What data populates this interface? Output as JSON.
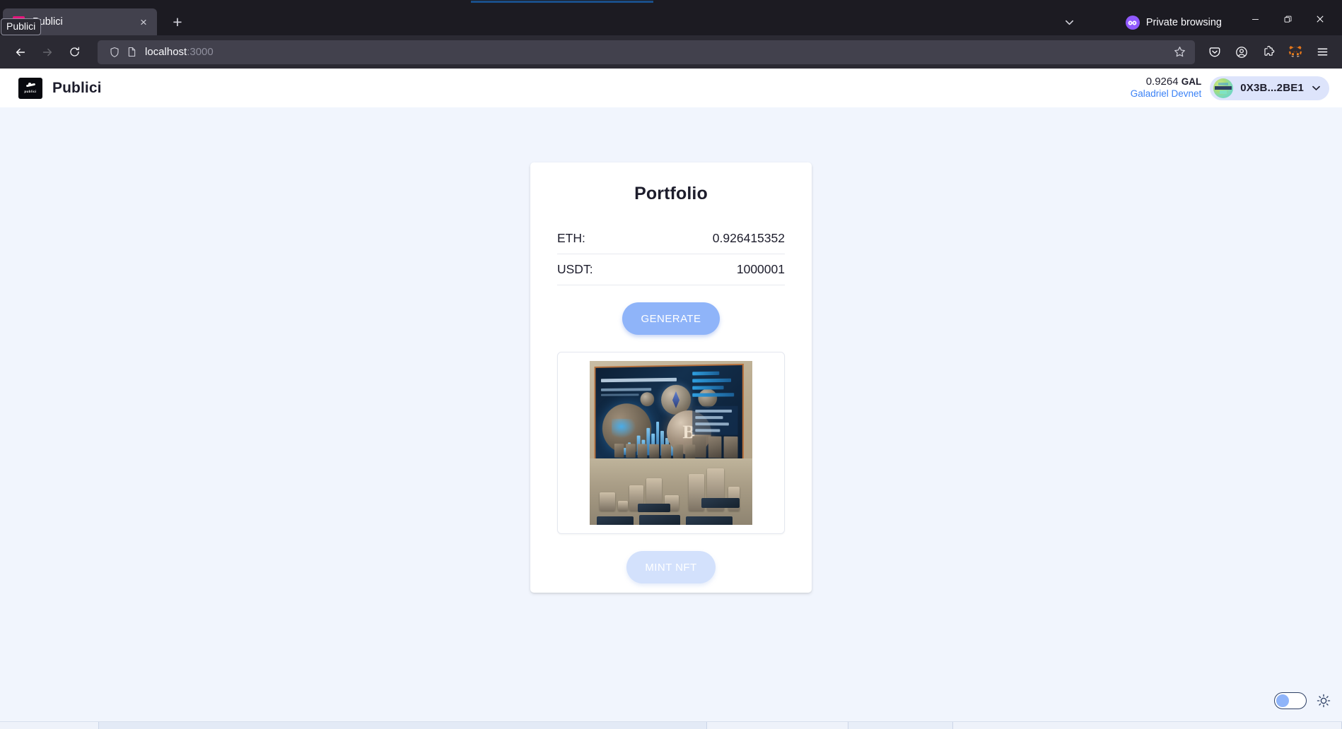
{
  "browser": {
    "tab": {
      "title": "Publici",
      "favicon_name": "publici-favicon",
      "close_label": "×",
      "tooltip": "Publici"
    },
    "new_tab_label": "+",
    "private_browsing_label": "Private browsing",
    "url": {
      "host": "localhost",
      "port": ":3000"
    },
    "window_controls": {
      "minimize": "—",
      "restore": "❐",
      "close": "✕"
    }
  },
  "app": {
    "brand": {
      "name": "Publici",
      "logo_wordmark": "publici"
    },
    "wallet": {
      "balance": "0.9264",
      "token": "GAL",
      "network": "Galadriel Devnet",
      "address": "0X3B...2BE1"
    },
    "card": {
      "title": "Portfolio",
      "rows": [
        {
          "label": "ETH:",
          "value": "0.926415352"
        },
        {
          "label": "USDT:",
          "value": "1000001"
        }
      ],
      "generate_label": "GENERATE",
      "mint_label": "MINT NFT",
      "nft_image_alt": "Non-Fungible Token Minting dashboard artwork"
    },
    "theme_toggle": {
      "state": "off",
      "icon": "sun-icon"
    }
  },
  "colors": {
    "page_background": "#f1f5fd",
    "card_background": "#ffffff",
    "accent_blue": "#8fb4f9",
    "accent_blue_disabled": "#d3e1fc",
    "network_link": "#3b82f6",
    "wallet_pill": "#dde4fb",
    "chrome_dark": "#2b2a33",
    "tab_active": "#42414d",
    "private_purple": "#9059ff",
    "text_primary": "#1d1d2c"
  }
}
